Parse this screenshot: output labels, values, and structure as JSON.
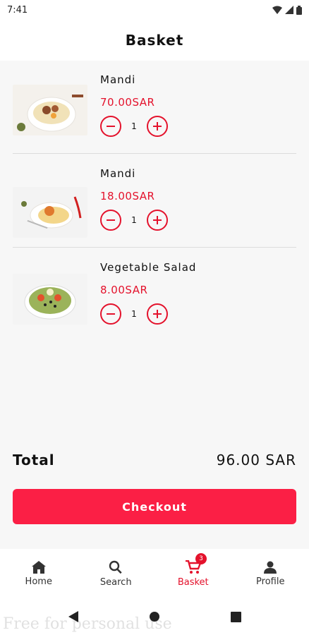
{
  "status_bar": {
    "time": "7:41"
  },
  "header": {
    "title": "Basket"
  },
  "items": [
    {
      "name": "Mandi",
      "price": "70.00SAR",
      "qty": "1"
    },
    {
      "name": "Mandi",
      "price": "18.00SAR",
      "qty": "1"
    },
    {
      "name": "Vegetable Salad",
      "price": "8.00SAR",
      "qty": "1"
    }
  ],
  "summary": {
    "total_label": "Total",
    "total_value": "96.00 SAR"
  },
  "checkout": {
    "label": "Checkout"
  },
  "nav": {
    "items": [
      {
        "label": "Home",
        "icon": "home-icon"
      },
      {
        "label": "Search",
        "icon": "search-icon"
      },
      {
        "label": "Basket",
        "icon": "cart-icon",
        "badge": "3"
      },
      {
        "label": "Profile",
        "icon": "person-icon"
      }
    ],
    "active": "Basket"
  },
  "watermark": "Free for personal use",
  "colors": {
    "accent": "#e4122c",
    "checkout_bg": "#fb1f45"
  }
}
